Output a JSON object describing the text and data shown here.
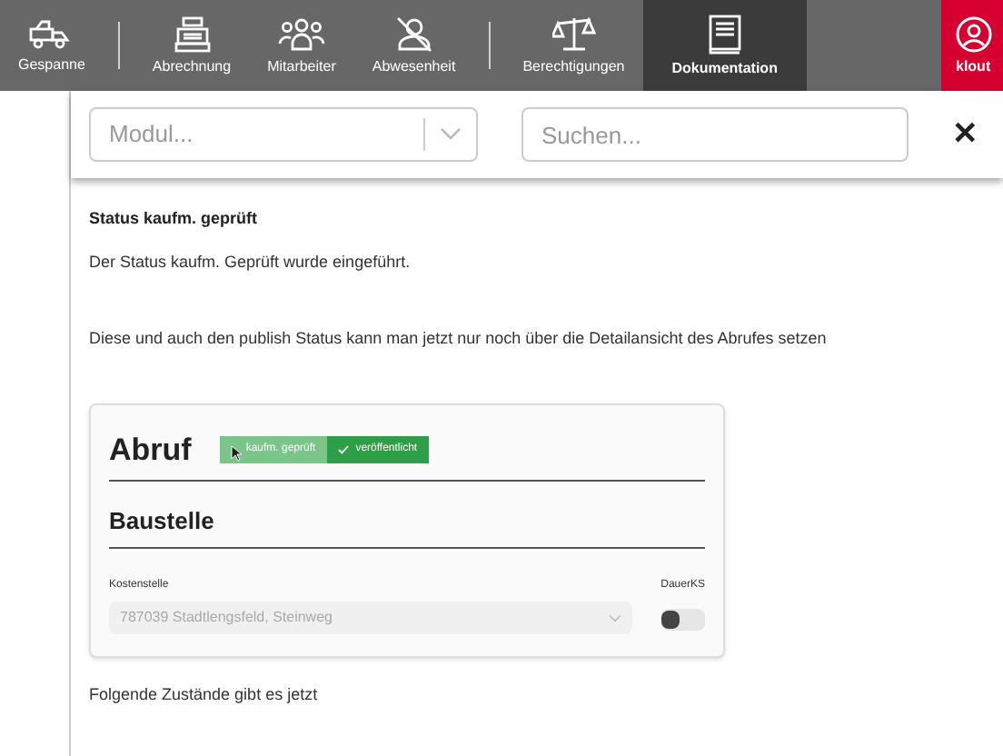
{
  "nav": {
    "items": [
      {
        "label": "Gespanne",
        "selected": false,
        "separator_after": true
      },
      {
        "label": "Abrechnung",
        "selected": false,
        "separator_after": false
      },
      {
        "label": "Mitarbeiter",
        "selected": false,
        "separator_after": false
      },
      {
        "label": "Abwesenheit",
        "selected": false,
        "separator_after": true
      },
      {
        "label": "Berechtigungen",
        "selected": false,
        "separator_after": false
      },
      {
        "label": "Dokumentation",
        "selected": true,
        "separator_after": false
      }
    ],
    "user": {
      "label": "klout"
    }
  },
  "filter": {
    "module": {
      "placeholder": "Modul..."
    },
    "search": {
      "placeholder": "Suchen..."
    },
    "close": "✕"
  },
  "article": {
    "title": "Status kaufm. geprüft",
    "paragraphs": [
      "Der Status kaufm. Geprüft wurde eingeführt.",
      "Diese und auch den publish Status kann man jetzt nur noch über die Detailansicht des Abrufes setzen"
    ],
    "screenshot": {
      "heading": "Abruf",
      "badges": [
        {
          "label": "kaufm. geprüft",
          "active": false
        },
        {
          "label": "veröffentlicht",
          "active": true
        }
      ],
      "section": "Baustelle",
      "field": {
        "label": "Kostenstelle",
        "value": "787039 Stadtlengsfeld, Steinweg"
      },
      "toggle": {
        "label": "DauerKS",
        "on": false
      }
    },
    "footer": "Folgende Zustände gibt es jetzt"
  }
}
